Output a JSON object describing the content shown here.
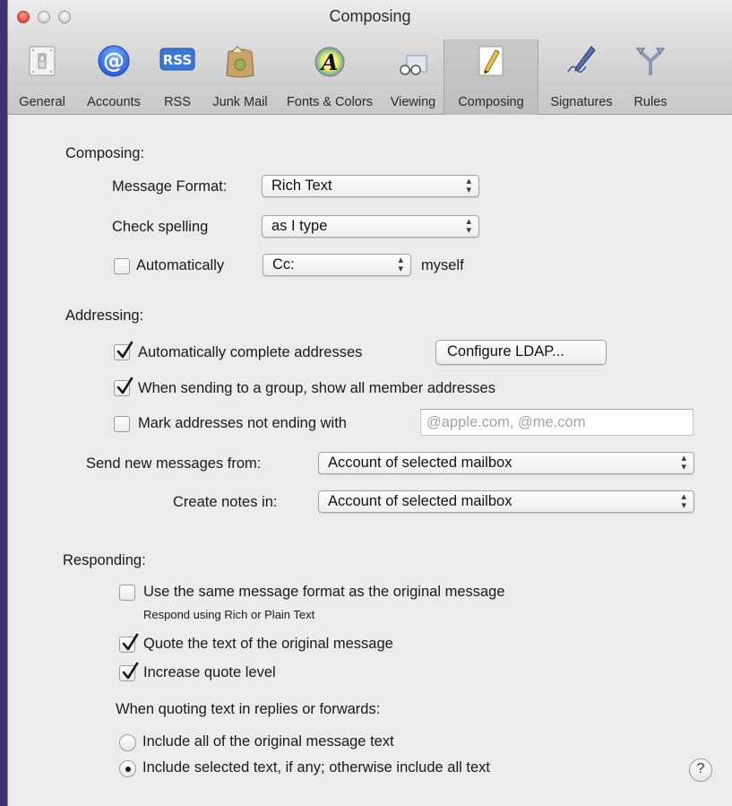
{
  "window": {
    "title": "Composing"
  },
  "toolbar": {
    "items": [
      {
        "label": "General",
        "icon": "light-switch-icon"
      },
      {
        "label": "Accounts",
        "icon": "at-sign-icon"
      },
      {
        "label": "RSS",
        "icon": "rss-icon",
        "badge": "RSS"
      },
      {
        "label": "Junk Mail",
        "icon": "junk-mail-bag-icon"
      },
      {
        "label": "Fonts & Colors",
        "icon": "fonts-colors-icon",
        "glyph": "A"
      },
      {
        "label": "Viewing",
        "icon": "viewing-glasses-icon"
      },
      {
        "label": "Composing",
        "icon": "pencil-icon",
        "active": true
      },
      {
        "label": "Signatures",
        "icon": "signature-pen-icon"
      },
      {
        "label": "Rules",
        "icon": "rules-icon"
      }
    ]
  },
  "composing": {
    "heading": "Composing:",
    "message_format_label": "Message Format:",
    "message_format_value": "Rich Text",
    "check_spelling_label": "Check spelling",
    "check_spelling_value": "as I type",
    "auto_cc_label": "Automatically",
    "auto_cc_checked": false,
    "auto_cc_value": "Cc:",
    "auto_cc_suffix": "myself"
  },
  "addressing": {
    "heading": "Addressing:",
    "auto_complete_label": "Automatically complete addresses",
    "auto_complete_checked": true,
    "configure_ldap_label": "Configure LDAP...",
    "group_label": "When sending to a group, show all member addresses",
    "group_checked": true,
    "mark_label": "Mark addresses not ending with",
    "mark_checked": false,
    "mark_placeholder": "@apple.com, @me.com",
    "send_from_label": "Send new messages from:",
    "send_from_value": "Account of selected mailbox",
    "notes_label": "Create notes in:",
    "notes_value": "Account of selected mailbox"
  },
  "responding": {
    "heading": "Responding:",
    "same_format_label": "Use the same message format as the original message",
    "same_format_checked": false,
    "same_format_hint": "Respond using Rich or Plain Text",
    "quote_label": "Quote the text of the original message",
    "quote_checked": true,
    "increase_label": "Increase quote level",
    "increase_checked": true,
    "quoting_heading": "When quoting text in replies or forwards:",
    "include_all_label": "Include all of the original message text",
    "include_selected_label": "Include selected text, if any; otherwise include all text",
    "selected_option": "include_selected"
  },
  "help": {
    "label": "?"
  },
  "colors": {
    "accent": "#3b2f70",
    "checkmark": "#1a1a1a",
    "window_bg": "#ececec"
  }
}
